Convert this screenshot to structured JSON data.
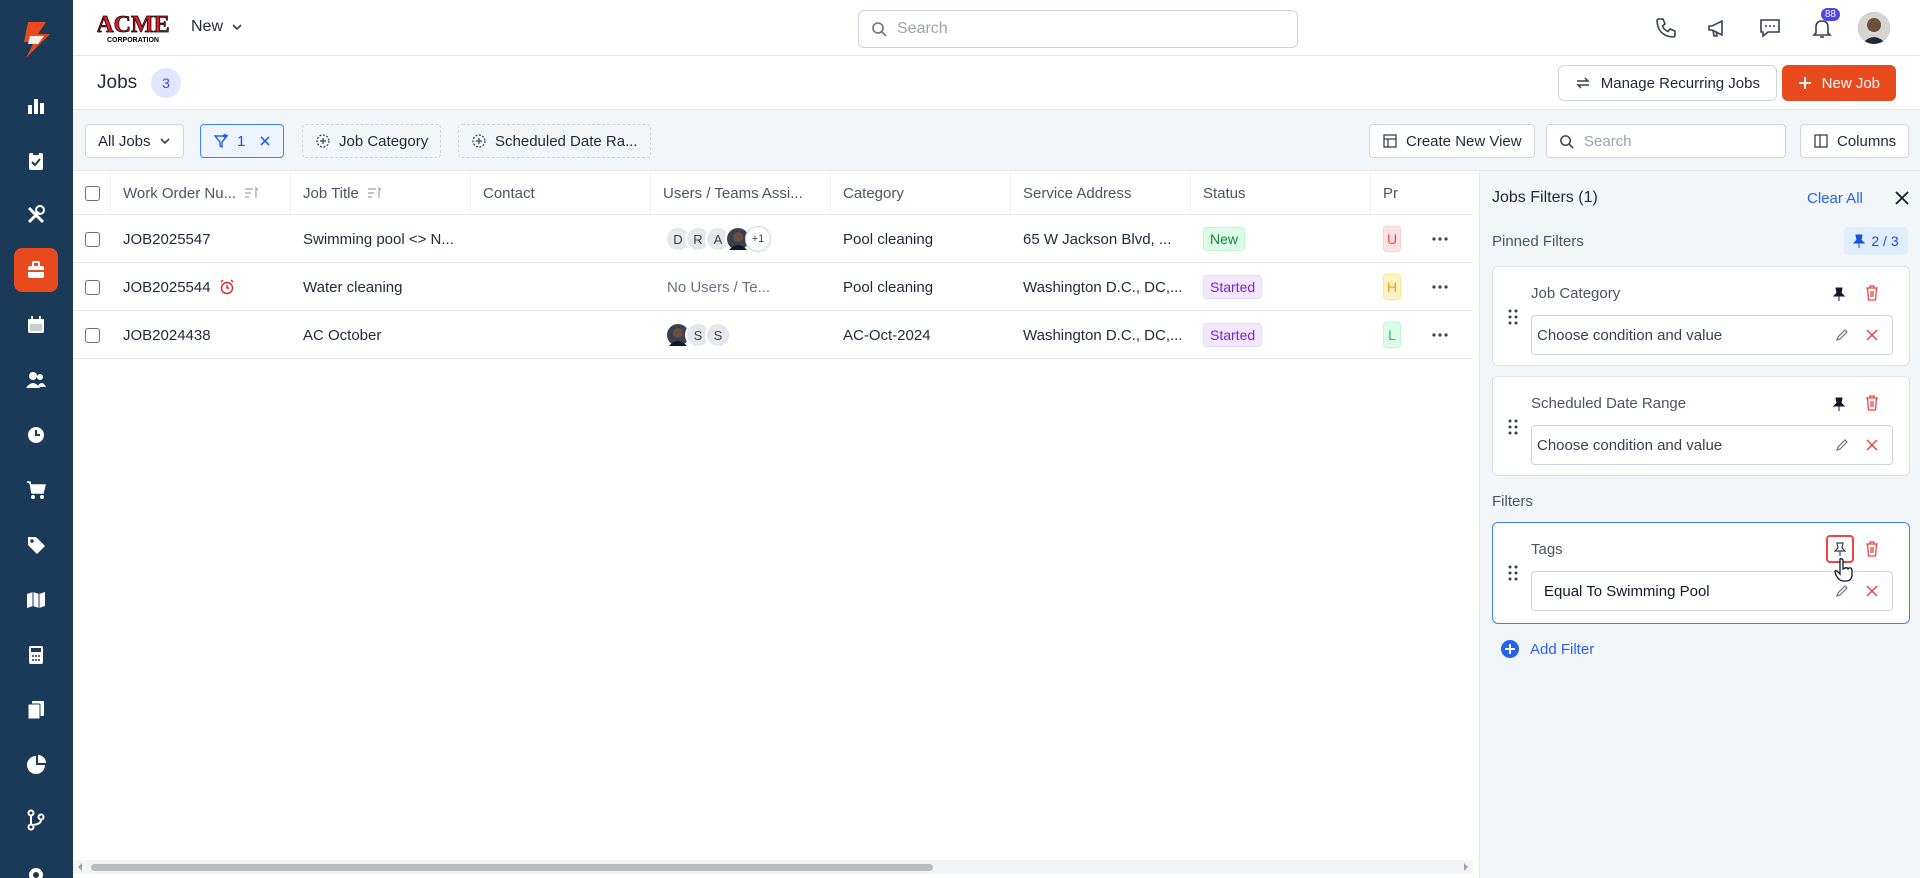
{
  "brand": {
    "logo_text": "ACME",
    "logo_sub": "CORPORATION"
  },
  "topbar": {
    "new_label": "New",
    "search_placeholder": "Search",
    "notification_count": "88"
  },
  "sidebar": {
    "items": [
      "reports-icon",
      "clipboard-icon",
      "tools-icon",
      "jobs-icon",
      "calendar-icon",
      "users-icon",
      "clock-icon",
      "cart-icon",
      "tag-icon",
      "map-icon",
      "calculator-icon",
      "documents-icon",
      "pie-chart-icon",
      "workflow-icon",
      "settings-icon"
    ],
    "active": "jobs-icon"
  },
  "page": {
    "title": "Jobs",
    "count": "3",
    "manage_label": "Manage Recurring Jobs",
    "new_job_label": "New Job"
  },
  "toolbar": {
    "view_label": "All Jobs",
    "filter_count": "1",
    "job_category_label": "Job Category",
    "date_range_label": "Scheduled Date Ra...",
    "create_view_label": "Create New View",
    "search_placeholder": "Search",
    "columns_label": "Columns"
  },
  "table": {
    "columns": [
      "Work Order Nu...",
      "Job Title",
      "Contact",
      "Users / Teams Assi...",
      "Category",
      "Service Address",
      "Status",
      "Pr"
    ],
    "rows": [
      {
        "wo": "JOB2025547",
        "title": "Swimming pool <> N...",
        "contact": "",
        "users": [
          "D",
          "R",
          "A"
        ],
        "more": "+1",
        "category": "Pool cleaning",
        "address": "65 W Jackson Blvd, ...",
        "status": "New",
        "priority": "U"
      },
      {
        "wo": "JOB2025544",
        "title": "Water cleaning",
        "contact": "",
        "users_text": "No Users / Te...",
        "category": "Pool cleaning",
        "address": "Washington D.C., DC,...",
        "status": "Started",
        "priority": "H"
      },
      {
        "wo": "JOB2024438",
        "title": "AC October",
        "contact": "",
        "users": [
          "S",
          "S"
        ],
        "category": "AC-Oct-2024",
        "address": "Washington D.C., DC,...",
        "status": "Started",
        "priority": "L"
      }
    ]
  },
  "filters": {
    "title": "Jobs Filters (1)",
    "clear_all": "Clear All",
    "pinned_label": "Pinned Filters",
    "pinned_count": "2 / 3",
    "filters_label": "Filters",
    "pinned": [
      {
        "name": "Job Category",
        "value": "Choose condition and value"
      },
      {
        "name": "Scheduled Date Range",
        "value": "Choose condition and value"
      }
    ],
    "active": [
      {
        "name": "Tags",
        "value": "Equal To Swimming Pool"
      }
    ],
    "add_label": "Add Filter"
  },
  "colors": {
    "accent": "#e8491d",
    "sidebar": "#1b3a57",
    "link": "#2563eb"
  }
}
